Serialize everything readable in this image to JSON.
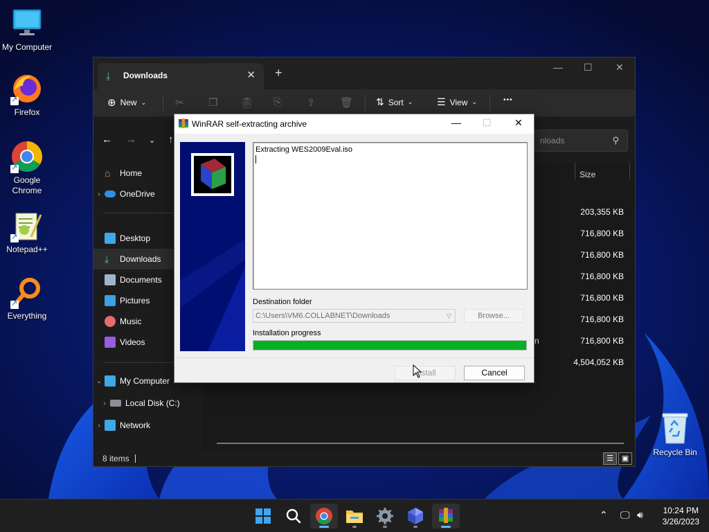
{
  "desktop": {
    "icons": [
      {
        "label": "My Computer",
        "icon": "monitor-icon"
      },
      {
        "label": "Firefox",
        "icon": "firefox-icon"
      },
      {
        "label": "Google Chrome",
        "icon": "chrome-icon"
      },
      {
        "label": "Notepad++",
        "icon": "notepadpp-icon"
      },
      {
        "label": "Everything",
        "icon": "everything-search-icon"
      }
    ],
    "recycle_bin": {
      "label": "Recycle Bin",
      "icon": "recycle-bin-icon"
    }
  },
  "explorer": {
    "tab_title": "Downloads",
    "toolbar": {
      "new_label": "New",
      "sort_label": "Sort",
      "view_label": "View",
      "more_label": "•••"
    },
    "search_placeholder": "nloads",
    "sidebar": {
      "home": "Home",
      "onedrive": "OneDrive",
      "desktop": "Desktop",
      "downloads": "Downloads",
      "documents": "Documents",
      "pictures": "Pictures",
      "music": "Music",
      "videos": "Videos",
      "my_computer": "My Computer",
      "local_disk": "Local Disk (C:)",
      "network": "Network"
    },
    "column_size": "Size",
    "rows": [
      {
        "name_fragment": "",
        "size": "203,355 KB"
      },
      {
        "name_fragment": "",
        "size": "716,800 KB"
      },
      {
        "name_fragment": "",
        "size": "716,800 KB"
      },
      {
        "name_fragment": "",
        "size": "716,800 KB"
      },
      {
        "name_fragment": "",
        "size": "716,800 KB"
      },
      {
        "name_fragment": "",
        "size": "716,800 KB"
      },
      {
        "name_fragment": "n",
        "size": "716,800 KB"
      },
      {
        "name_fragment": "",
        "size": "4,504,052 KB"
      }
    ],
    "status_items": "8 items"
  },
  "dialog": {
    "title": "WinRAR self-extracting archive",
    "log_text": "Extracting WES2009Eval.iso",
    "destination_label": "Destination folder",
    "destination_value": "C:\\Users\\VM6.COLLABNET\\Downloads",
    "browse_label": "Browse...",
    "progress_label": "Installation progress",
    "progress_fraction": 1.0,
    "install_label": "Install",
    "cancel_label": "Cancel"
  },
  "taskbar": {
    "apps": [
      "start-icon",
      "search-icon",
      "chrome-icon",
      "file-explorer-icon",
      "settings-icon",
      "app-icon",
      "winrar-icon"
    ],
    "clock_time": "10:24 PM",
    "clock_date": "3/26/2023"
  },
  "colors": {
    "progress_green": "#06b025",
    "taskbar_bg": "#1f1f1f",
    "explorer_bg": "#1c1c1c",
    "dialog_banner": "#000e72"
  }
}
